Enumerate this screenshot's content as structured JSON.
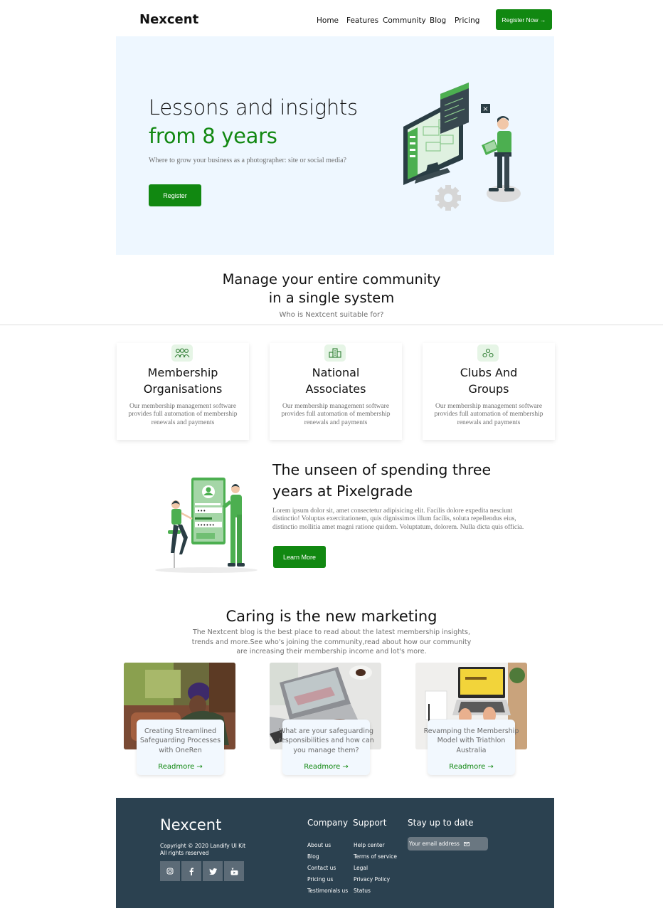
{
  "header": {
    "brand": "Nexcent",
    "nav": [
      "Home",
      "Features",
      "Community",
      "Blog",
      "Pricing"
    ],
    "cta": "Register Now →"
  },
  "hero": {
    "title_line1": "Lessons and insights",
    "title_line2": "from 8 years",
    "subtitle": "Where to grow your business as a photographer: site or social media?",
    "button": "Register"
  },
  "community": {
    "title_line1": "Manage your entire community",
    "title_line2": "in a single system",
    "subtitle": "Who is Nextcent suitable for?",
    "cards": [
      {
        "title_line1": "Membership",
        "title_line2": "Organisations",
        "text": "Our membership management software provides full automation of membership renewals and payments",
        "icon": "people-group-icon"
      },
      {
        "title_line1": "National",
        "title_line2": "Associates",
        "text": "Our membership management software provides full automation of membership renewals and payments",
        "icon": "buildings-icon"
      },
      {
        "title_line1": "Clubs And",
        "title_line2": "Groups",
        "text": "Our membership management software provides full automation of membership renewals and payments",
        "icon": "hand-group-icon"
      }
    ]
  },
  "feature": {
    "title_line1": "The unseen of spending three",
    "title_line2": "years at Pixelgrade",
    "text": "Lorem ipsum dolor sit, amet consectetur adipisicing elit. Facilis dolore expedita nesciunt distinctio! Voluptas exercitationem, quis dignissimos illum facilis, soluta repellendus eius, distinctio mollitia amet magni ratione quidem. Voluptatum, dolorem. Nulla dicta quis officia.",
    "button": "Learn More",
    "login_dots_1": "•••",
    "login_dots_2": "••••••"
  },
  "blog": {
    "title": "Caring is the new marketing",
    "subtitle_line1": "The Nextcent blog is the best place to read about the latest membership insights,",
    "subtitle_line2": "trends and more.See who's joining the community,read about how our community",
    "subtitle_line3": "are increasing their membership income and lot's more.",
    "posts": [
      {
        "title": "Creating Streamlined Safeguarding Processes with OneRen",
        "link": "Readmore →"
      },
      {
        "title": "What are your safeguarding responsibilities and how can you manage them?",
        "link": "Readmore →"
      },
      {
        "title": "Revamping the Membership Model with Triathlon Australia",
        "link": "Readmore →"
      }
    ]
  },
  "footer": {
    "brand": "Nexcent",
    "copyright": "Copyright © 2020 Landify UI Kit",
    "rights": "All rights reserved",
    "company_heading": "Company",
    "company_links": [
      "About us",
      "Blog",
      "Contact us",
      "Pricing us",
      "Testimonials us"
    ],
    "support_heading": "Support",
    "support_links": [
      "Help center",
      "Terms of service",
      "Legal",
      "Privacy Policy",
      "Status"
    ],
    "newsletter_heading": "Stay up to date",
    "email_placeholder": "Your email address",
    "socials": [
      "instagram-icon",
      "facebook-icon",
      "twitter-icon",
      "youtube-icon"
    ]
  },
  "colors": {
    "accent": "#118811",
    "hero_bg": "#eef7ff",
    "footer_bg": "#2b4150"
  }
}
